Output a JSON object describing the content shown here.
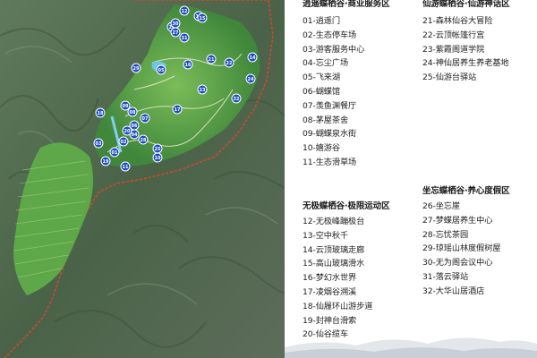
{
  "map": {
    "markers": [
      "01",
      "02",
      "03",
      "04",
      "05",
      "06",
      "07",
      "08",
      "09",
      "10",
      "11",
      "12",
      "13",
      "14",
      "15",
      "16",
      "17",
      "18",
      "19",
      "20",
      "21",
      "22",
      "23",
      "24",
      "25",
      "26",
      "27",
      "28",
      "29",
      "30",
      "31",
      "32"
    ],
    "colors": {
      "marker": "#1f4fbf",
      "boundary": "#d6452f",
      "terrain": "#4e6b4f",
      "vegetation": "#6ab04c"
    }
  },
  "legend": {
    "sec1": {
      "title": "逍遥蝶栖谷·商业服务区",
      "items": [
        "01-逍遥门",
        "02-生态停车场",
        "03-游客服务中心",
        "04-忘尘广场",
        "05-飞来湖",
        "06-蝴蝶馆",
        "07-羡鱼渊餐厅",
        "08-茅屋茶舍",
        "09-蝴蝶泉水街",
        "10-嬉游谷",
        "11-生态滑草场"
      ]
    },
    "sec2": {
      "title": "仙游蝶栖谷·仙游神话区",
      "items": [
        "21-森林仙谷大冒险",
        "22-云顶帐篷行宫",
        "23-紫霞阁道学院",
        "24-神仙居养生养老基地",
        "25-仙游台驿站"
      ]
    },
    "sec3": {
      "title": "无极蝶栖谷·极限运动区",
      "items": [
        "12-无极峰蹦极台",
        "13-空中秋千",
        "14-云顶玻璃走廊",
        "15-高山玻璃滑水",
        "16-梦幻水世界",
        "17-凌烟谷溯溪",
        "18-仙履环山游步道",
        "19-封神台滑索",
        "20-仙谷缆车"
      ]
    },
    "sec4": {
      "title": "坐忘蝶栖谷·养心度假区",
      "items": [
        "26-坐忘崖",
        "27-梦蝶居养生中心",
        "28-忘忧茶园",
        "29-琼瑶山林度假树屋",
        "30-无为阁会议中心",
        "31-落云驿站",
        "32-大华山居酒店"
      ]
    }
  }
}
